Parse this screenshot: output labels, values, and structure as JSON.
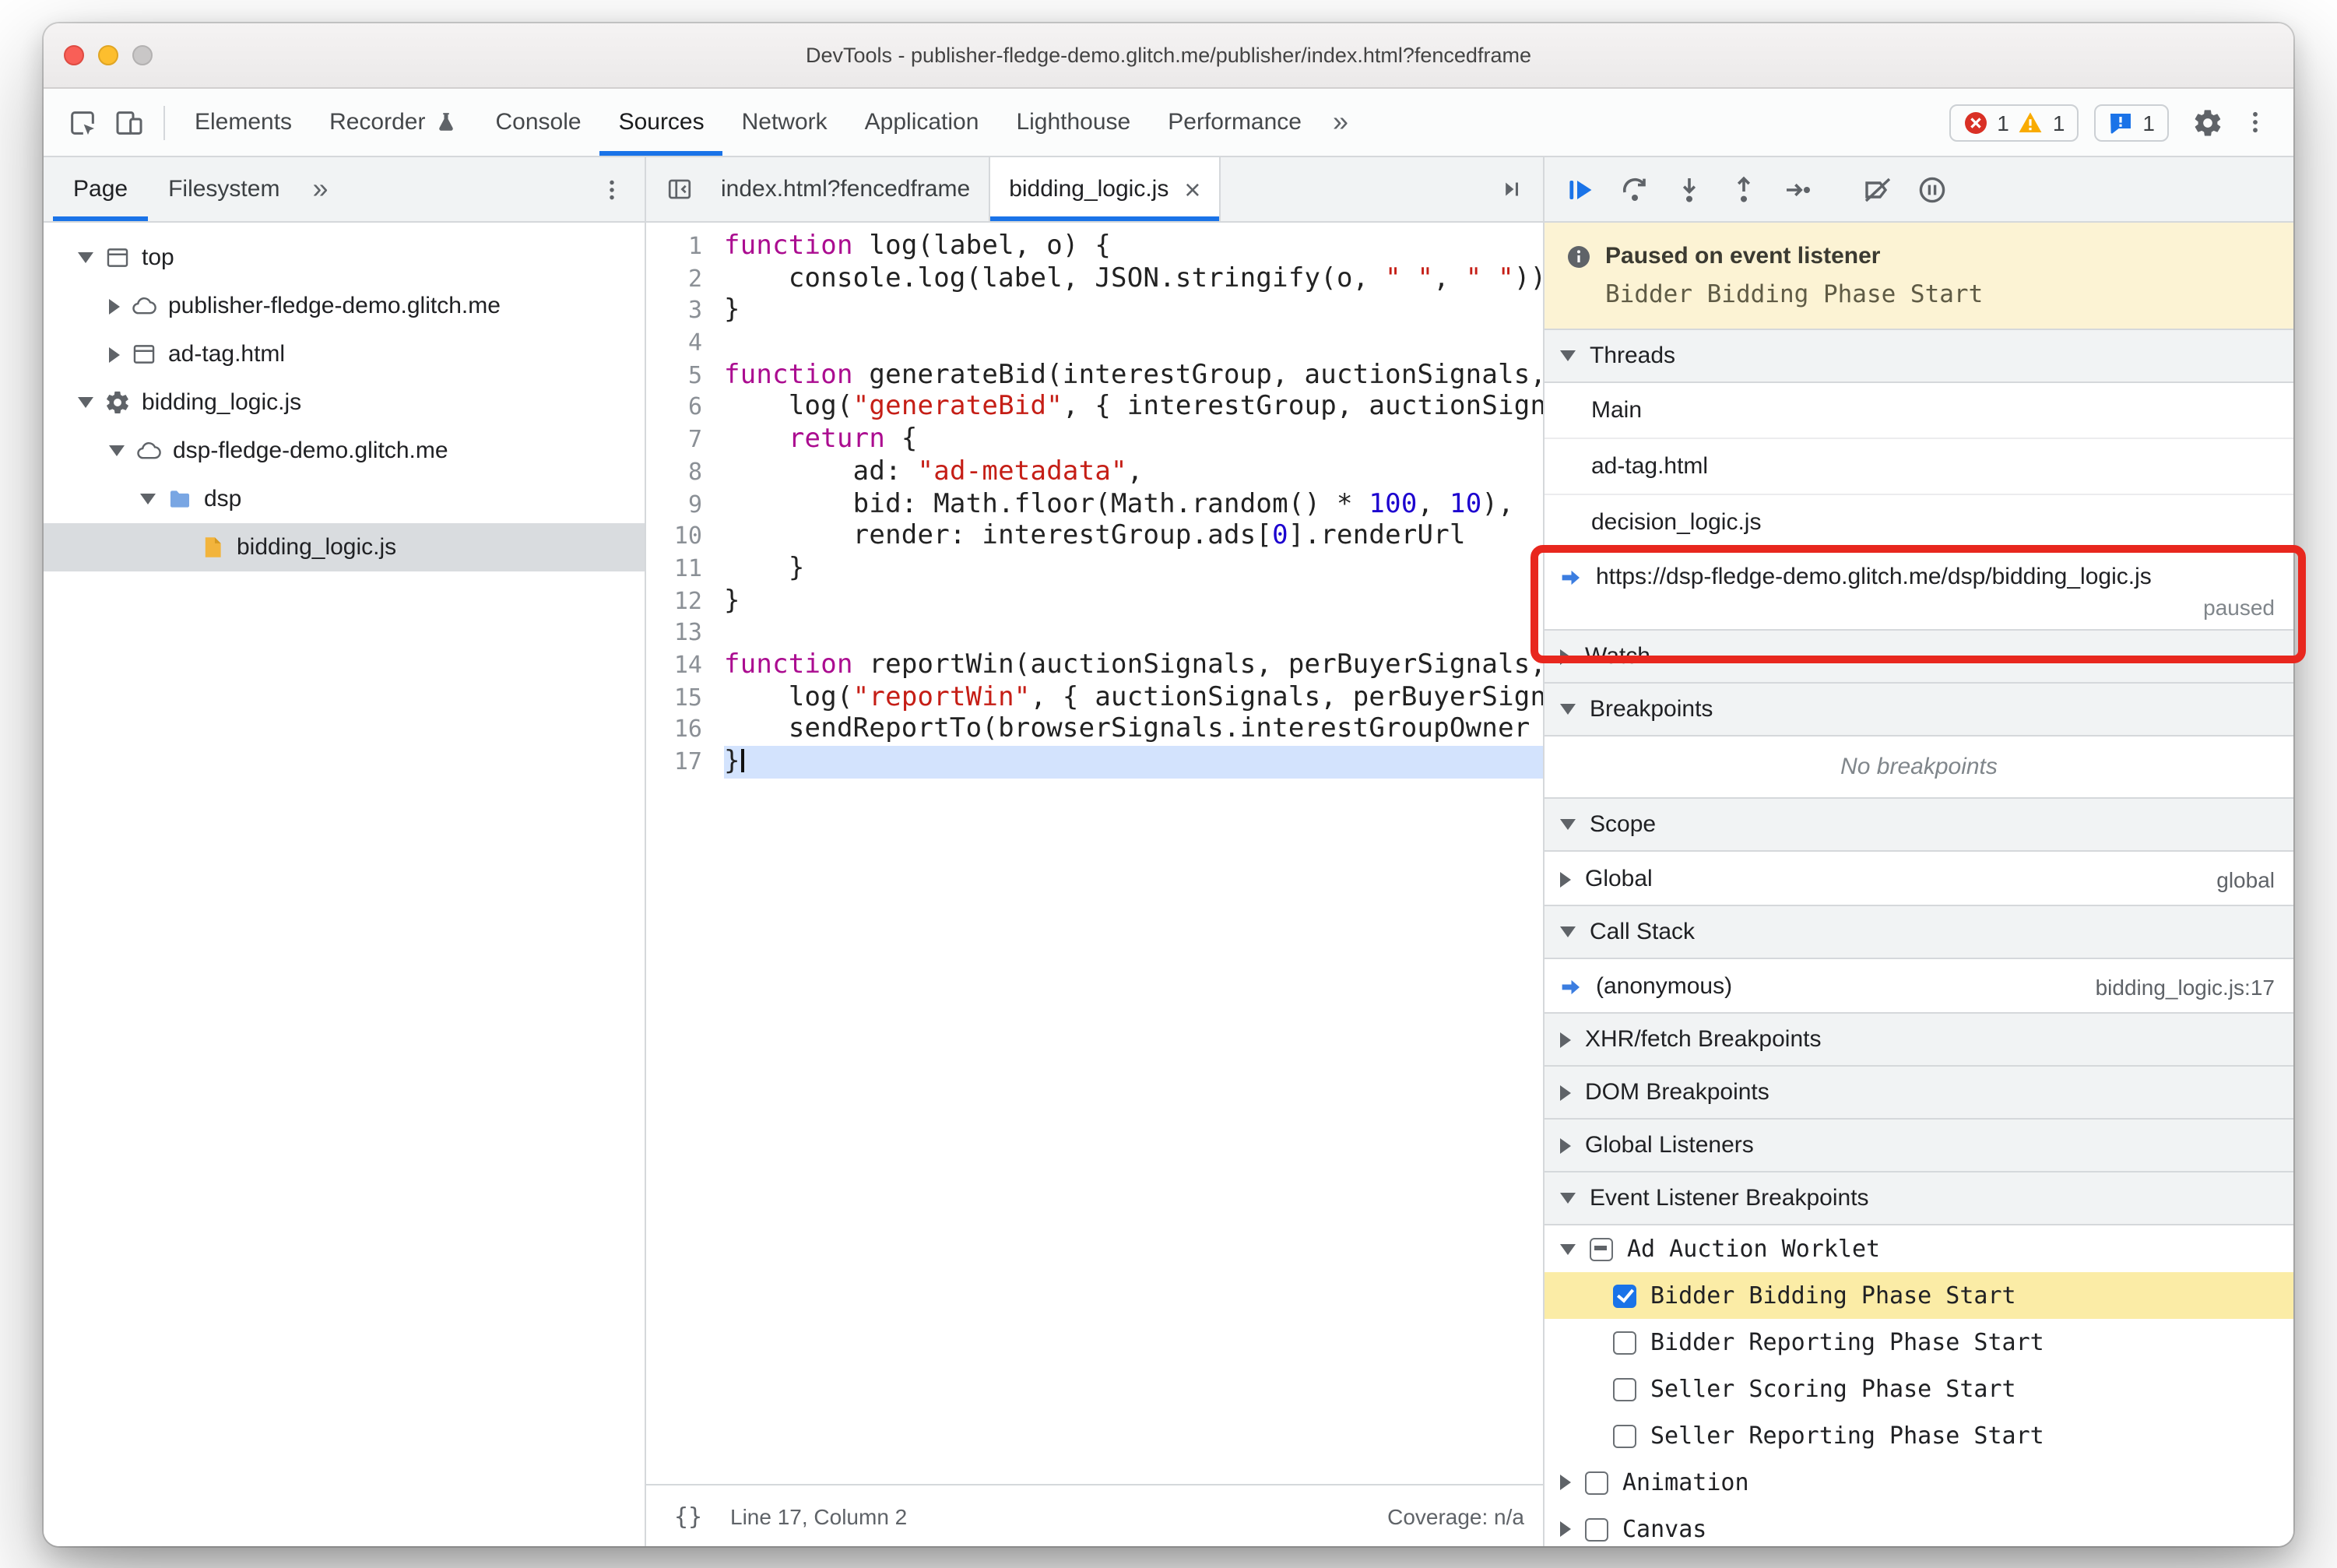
{
  "window": {
    "title": "DevTools - publisher-fledge-demo.glitch.me/publisher/index.html?fencedframe"
  },
  "colors": {
    "accent_blue": "#1a73e8",
    "error_red": "#d93025",
    "warning_yellow": "#f9ab00",
    "paused_banner_bg": "#fcf3d4",
    "breakpoint_highlight_bg": "#fbeca6",
    "annotation_red": "#e8271e",
    "keyword": "#ab0c90",
    "string": "#c51e16",
    "number": "#1c00cf"
  },
  "toolbar": {
    "tabs": [
      {
        "label": "Elements"
      },
      {
        "label": "Recorder",
        "badge": true
      },
      {
        "label": "Console"
      },
      {
        "label": "Sources",
        "selected": true
      },
      {
        "label": "Network"
      },
      {
        "label": "Application"
      },
      {
        "label": "Lighthouse"
      },
      {
        "label": "Performance"
      }
    ],
    "overflow": "»",
    "error_count": "1",
    "warning_count": "1",
    "issues_count": "1"
  },
  "navigator": {
    "tabs": [
      "Page",
      "Filesystem"
    ],
    "overflow": "»",
    "tree": [
      {
        "label": "top",
        "level": 0,
        "icon": "frame",
        "arrow": "down"
      },
      {
        "label": "publisher-fledge-demo.glitch.me",
        "level": 1,
        "icon": "cloud",
        "arrow": "right"
      },
      {
        "label": "ad-tag.html",
        "level": 1,
        "icon": "frame",
        "arrow": "right"
      },
      {
        "label": "bidding_logic.js",
        "level": 0,
        "icon": "gear",
        "arrow": "down"
      },
      {
        "label": "dsp-fledge-demo.glitch.me",
        "level": 1,
        "icon": "cloud",
        "arrow": "down"
      },
      {
        "label": "dsp",
        "level": 2,
        "icon": "folder",
        "arrow": "down"
      },
      {
        "label": "bidding_logic.js",
        "level": 3,
        "icon": "filejs",
        "arrow": null,
        "selected": true
      }
    ]
  },
  "editor": {
    "tabs": [
      {
        "label": "index.html?fencedframe"
      },
      {
        "label": "bidding_logic.js",
        "active": true
      }
    ],
    "active_line": 17,
    "lines": [
      [
        {
          "c": "kw",
          "t": "function"
        },
        {
          "c": "pln",
          "t": " log(label, o) {"
        }
      ],
      [
        {
          "c": "pln",
          "t": "    console.log(label, JSON.stringify(o, "
        },
        {
          "c": "str",
          "t": "\" \""
        },
        {
          "c": "pln",
          "t": ", "
        },
        {
          "c": "str",
          "t": "\" \""
        },
        {
          "c": "pln",
          "t": "));"
        }
      ],
      [
        {
          "c": "pln",
          "t": "}"
        }
      ],
      [],
      [
        {
          "c": "kw",
          "t": "function"
        },
        {
          "c": "pln",
          "t": " generateBid(interestGroup, auctionSignals, perBuyerSignals, trustedBiddingSignals, browserSignals) {"
        }
      ],
      [
        {
          "c": "pln",
          "t": "    log("
        },
        {
          "c": "str",
          "t": "\"generateBid\""
        },
        {
          "c": "pln",
          "t": ", { interestGroup, auctionSignals, perBuyerSignals, trustedBiddingSignals, browserSignals });"
        }
      ],
      [
        {
          "c": "pln",
          "t": "    "
        },
        {
          "c": "kw",
          "t": "return"
        },
        {
          "c": "pln",
          "t": " {"
        }
      ],
      [
        {
          "c": "pln",
          "t": "        ad: "
        },
        {
          "c": "str",
          "t": "\"ad-metadata\""
        },
        {
          "c": "pln",
          "t": ","
        }
      ],
      [
        {
          "c": "pln",
          "t": "        bid: Math.floor(Math.random() * "
        },
        {
          "c": "num",
          "t": "100"
        },
        {
          "c": "pln",
          "t": ", "
        },
        {
          "c": "num",
          "t": "10"
        },
        {
          "c": "pln",
          "t": "),"
        }
      ],
      [
        {
          "c": "pln",
          "t": "        render: interestGroup.ads["
        },
        {
          "c": "num",
          "t": "0"
        },
        {
          "c": "pln",
          "t": "].renderUrl"
        }
      ],
      [
        {
          "c": "pln",
          "t": "    }"
        }
      ],
      [
        {
          "c": "pln",
          "t": "}"
        }
      ],
      [],
      [
        {
          "c": "kw",
          "t": "function"
        },
        {
          "c": "pln",
          "t": " reportWin(auctionSignals, perBuyerSignals, sellerSignals, browserSignals) {"
        }
      ],
      [
        {
          "c": "pln",
          "t": "    log("
        },
        {
          "c": "str",
          "t": "\"reportWin\""
        },
        {
          "c": "pln",
          "t": ", { auctionSignals, perBuyerSignals, sellerSignals, browserSignals });"
        }
      ],
      [
        {
          "c": "pln",
          "t": "    sendReportTo(browserSignals.interestGroupOwner + browserSignals.renderUrl);"
        }
      ],
      [
        {
          "c": "pln",
          "t": "}"
        }
      ]
    ],
    "status": {
      "pretty_print": "{}",
      "line_col": "Line 17, Column 2",
      "coverage": "Coverage: n/a"
    }
  },
  "debugger": {
    "banner": {
      "title": "Paused on event listener",
      "subtitle": "Bidder Bidding Phase Start"
    },
    "threads": {
      "title": "Threads",
      "items": [
        {
          "label": "Main"
        },
        {
          "label": "ad-tag.html"
        },
        {
          "label": "decision_logic.js"
        },
        {
          "label": "https://dsp-fledge-demo.glitch.me/dsp/bidding_logic.js",
          "status": "paused",
          "current": true
        }
      ]
    },
    "watch_title": "Watch",
    "breakpoints": {
      "title": "Breakpoints",
      "empty": "No breakpoints"
    },
    "scope": {
      "title": "Scope",
      "rows": [
        {
          "label": "Global",
          "value": "global"
        }
      ]
    },
    "call_stack": {
      "title": "Call Stack",
      "rows": [
        {
          "label": "(anonymous)",
          "location": "bidding_logic.js:17"
        }
      ]
    },
    "xhr_title": "XHR/fetch Breakpoints",
    "dom_title": "DOM Breakpoints",
    "global_listeners_title": "Global Listeners",
    "event_listener_breakpoints": {
      "title": "Event Listener Breakpoints",
      "groups": [
        {
          "label": "Ad Auction Worklet",
          "state": "indeterminate",
          "expanded": true,
          "children": [
            {
              "label": "Bidder Bidding Phase Start",
              "checked": true,
              "highlighted": true
            },
            {
              "label": "Bidder Reporting Phase Start",
              "checked": false
            },
            {
              "label": "Seller Scoring Phase Start",
              "checked": false
            },
            {
              "label": "Seller Reporting Phase Start",
              "checked": false
            }
          ]
        },
        {
          "label": "Animation",
          "state": "unchecked",
          "expanded": false
        },
        {
          "label": "Canvas",
          "state": "unchecked",
          "expanded": false
        }
      ]
    }
  }
}
